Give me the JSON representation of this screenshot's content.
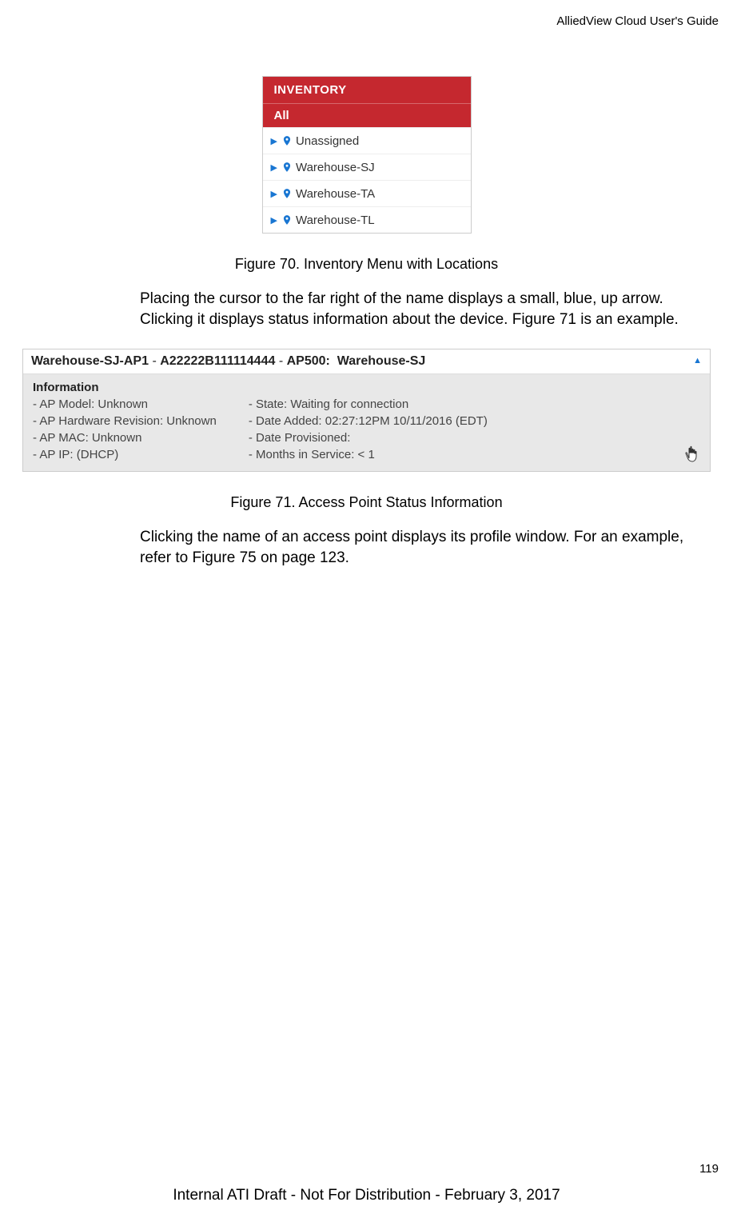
{
  "header": {
    "guideTitle": "AlliedView Cloud User's Guide"
  },
  "figure70": {
    "menuTitle": "INVENTORY",
    "allLabel": "All",
    "items": [
      "Unassigned",
      "Warehouse-SJ",
      "Warehouse-TA",
      "Warehouse-TL"
    ],
    "caption": "Figure 70. Inventory Menu with Locations"
  },
  "paragraph1": "Placing the cursor to the far right of the name displays a small, blue, up arrow. Clicking it displays status information about the device. Figure 71 is an example.",
  "figure71": {
    "titleName": "Warehouse-SJ-AP1",
    "titleSep1": " - ",
    "titleSerial": "A22222B111114444",
    "titleSep2": " - ",
    "titleModel": "AP500:",
    "titleLocation": "Warehouse-SJ",
    "infoHeader": "Information",
    "col1": {
      "line1": "- AP Model: Unknown",
      "line2": "- AP Hardware Revision: Unknown",
      "line3": "- AP MAC: Unknown",
      "line4": "- AP IP: (DHCP)"
    },
    "col2": {
      "line1": "- State: Waiting for connection",
      "line2": "- Date Added: 02:27:12PM 10/11/2016 (EDT)",
      "line3": "- Date Provisioned:",
      "line4": "- Months in Service: < 1"
    },
    "caption": "Figure 71. Access Point Status Information"
  },
  "paragraph2": "Clicking the name of an access point displays its profile window. For an example, refer to Figure 75 on page 123.",
  "pageNumber": "119",
  "footer": "Internal ATI Draft - Not For Distribution - February 3, 2017"
}
